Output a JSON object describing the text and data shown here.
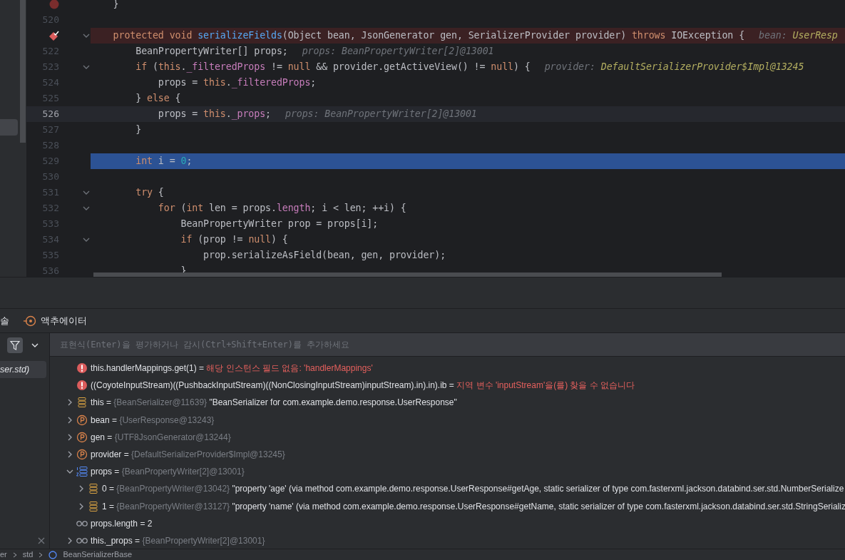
{
  "editor": {
    "lines": [
      {
        "breakpoint": true,
        "suspended": false,
        "foldable": false,
        "current": false,
        "execution_point": false,
        "tokens": [
          {
            "kind": "plain",
            "text": "    }"
          }
        ]
      },
      {
        "number": "520",
        "breakpoint": false,
        "suspended": false,
        "foldable": false,
        "current": false,
        "execution_point": false
      },
      {
        "breakpoint": true,
        "suspended": true,
        "foldable": true,
        "current": false,
        "execution_point": false,
        "tokens": [
          {
            "kind": "kw",
            "text": "    protected void"
          },
          {
            "kind": "fn",
            "text": " serializeFields"
          },
          {
            "kind": "plain",
            "text": "(Object bean, JsonGenerator gen, SerializerProvider provider)"
          },
          {
            "kind": "kw",
            "text": " throws"
          },
          {
            "kind": "plain",
            "text": " IOException {"
          }
        ],
        "hints": [
          {
            "label": "bean:",
            "value": "UserResp",
            "highlighted": true
          }
        ]
      },
      {
        "number": "522",
        "breakpoint": false,
        "suspended": false,
        "foldable": false,
        "current": false,
        "execution_point": false,
        "tokens": [
          {
            "kind": "plain",
            "text": "        BeanPropertyWriter[] props;"
          }
        ],
        "hints": [
          {
            "label": "props:",
            "value": "BeanPropertyWriter[2]@13001",
            "highlighted": false
          }
        ]
      },
      {
        "number": "523",
        "breakpoint": false,
        "suspended": false,
        "foldable": true,
        "current": false,
        "execution_point": false,
        "tokens": [
          {
            "kind": "kw",
            "text": "        if"
          },
          {
            "kind": "plain",
            "text": " ("
          },
          {
            "kind": "kw",
            "text": "this"
          },
          {
            "kind": "plain",
            "text": "."
          },
          {
            "kind": "field",
            "text": "_filteredProps"
          },
          {
            "kind": "plain",
            "text": " != "
          },
          {
            "kind": "kw",
            "text": "null"
          },
          {
            "kind": "plain",
            "text": " && provider.getActiveView() != "
          },
          {
            "kind": "kw",
            "text": "null"
          },
          {
            "kind": "plain",
            "text": ") {"
          }
        ],
        "hints": [
          {
            "label": "provider:",
            "value": "DefaultSerializerProvider$Impl@13245",
            "highlighted": true
          }
        ]
      },
      {
        "number": "524",
        "breakpoint": false,
        "suspended": false,
        "foldable": false,
        "current": false,
        "execution_point": false,
        "tokens": [
          {
            "kind": "plain",
            "text": "            props = "
          },
          {
            "kind": "kw",
            "text": "this"
          },
          {
            "kind": "plain",
            "text": "."
          },
          {
            "kind": "field",
            "text": "_filteredProps"
          },
          {
            "kind": "plain",
            "text": ";"
          }
        ]
      },
      {
        "number": "525",
        "breakpoint": false,
        "suspended": false,
        "foldable": false,
        "current": false,
        "execution_point": false,
        "tokens": [
          {
            "kind": "plain",
            "text": "        } "
          },
          {
            "kind": "kw",
            "text": "else"
          },
          {
            "kind": "plain",
            "text": " {"
          }
        ]
      },
      {
        "number": "526",
        "breakpoint": false,
        "suspended": false,
        "foldable": false,
        "current": true,
        "execution_point": false,
        "tokens": [
          {
            "kind": "plain",
            "text": "            props = "
          },
          {
            "kind": "kw",
            "text": "this"
          },
          {
            "kind": "plain",
            "text": "."
          },
          {
            "kind": "field",
            "text": "_props"
          },
          {
            "kind": "plain",
            "text": ";"
          }
        ],
        "hints": [
          {
            "label": "props:",
            "value": "BeanPropertyWriter[2]@13001",
            "highlighted": false
          }
        ]
      },
      {
        "number": "527",
        "breakpoint": false,
        "suspended": false,
        "foldable": false,
        "current": false,
        "execution_point": false,
        "tokens": [
          {
            "kind": "plain",
            "text": "        }"
          }
        ]
      },
      {
        "number": "528",
        "breakpoint": false,
        "suspended": false,
        "foldable": false,
        "current": false,
        "execution_point": false
      },
      {
        "number": "529",
        "breakpoint": false,
        "suspended": false,
        "foldable": false,
        "current": false,
        "execution_point": true,
        "tokens": [
          {
            "kind": "kw",
            "text": "        int"
          },
          {
            "kind": "plain",
            "text": " i = "
          },
          {
            "kind": "num",
            "text": "0"
          },
          {
            "kind": "plain",
            "text": ";"
          }
        ]
      },
      {
        "number": "530",
        "breakpoint": false,
        "suspended": false,
        "foldable": false,
        "current": false,
        "execution_point": false
      },
      {
        "number": "531",
        "breakpoint": false,
        "suspended": false,
        "foldable": true,
        "current": false,
        "execution_point": false,
        "tokens": [
          {
            "kind": "kw",
            "text": "        try"
          },
          {
            "kind": "plain",
            "text": " {"
          }
        ]
      },
      {
        "number": "532",
        "breakpoint": false,
        "suspended": false,
        "foldable": true,
        "current": false,
        "execution_point": false,
        "tokens": [
          {
            "kind": "kw",
            "text": "            for"
          },
          {
            "kind": "plain",
            "text": " ("
          },
          {
            "kind": "kw",
            "text": "int"
          },
          {
            "kind": "plain",
            "text": " len = props."
          },
          {
            "kind": "field",
            "text": "length"
          },
          {
            "kind": "plain",
            "text": "; i < len; ++i) {"
          }
        ]
      },
      {
        "number": "533",
        "breakpoint": false,
        "suspended": false,
        "foldable": false,
        "current": false,
        "execution_point": false,
        "tokens": [
          {
            "kind": "plain",
            "text": "                BeanPropertyWriter prop = props[i];"
          }
        ]
      },
      {
        "number": "534",
        "breakpoint": false,
        "suspended": false,
        "foldable": true,
        "current": false,
        "execution_point": false,
        "tokens": [
          {
            "kind": "kw",
            "text": "                if"
          },
          {
            "kind": "plain",
            "text": " (prop != "
          },
          {
            "kind": "kw",
            "text": "null"
          },
          {
            "kind": "plain",
            "text": ") {"
          }
        ]
      },
      {
        "number": "535",
        "breakpoint": false,
        "suspended": false,
        "foldable": false,
        "current": false,
        "execution_point": false,
        "tokens": [
          {
            "kind": "plain",
            "text": "                    prop.serializeAsField(bean, gen, provider);"
          }
        ]
      },
      {
        "number": "536",
        "breakpoint": false,
        "suspended": false,
        "foldable": false,
        "current": false,
        "execution_point": false,
        "tokens": [
          {
            "kind": "plain",
            "text": "                }"
          }
        ]
      }
    ]
  },
  "debugger": {
    "tabs": [
      {
        "kind": "plain",
        "label": "솔"
      },
      {
        "kind": "target",
        "label": "액추에이터"
      }
    ],
    "frames": [
      {
        "label": "ser.std)",
        "selected": true
      }
    ],
    "expression": {
      "placeholder": "표현식(Enter)을 평가하거나 감시(Ctrl+Shift+Enter)를 추가하세요"
    },
    "variables": [
      {
        "kind": "error",
        "name": "this.handlerMappings.get(1)",
        "sep": "=",
        "error": "해당 인스턴스 필드 없음: 'handlerMappings'"
      },
      {
        "kind": "error",
        "name": "((CoyoteInputStream)((PushbackInputStream)((NonClosingInputStream)inputStream).in).in).ib",
        "sep": "=",
        "error": "지역 변수 'inputStream'을(를) 찾을 수 없습니다"
      },
      {
        "kind": "object",
        "expanded": false,
        "name": "this",
        "sep": "=",
        "type": "{BeanSerializer@11639}",
        "value": "\"BeanSerializer for com.example.demo.response.UserResponse\""
      },
      {
        "kind": "param",
        "expanded": false,
        "name": "bean",
        "sep": "=",
        "type": "{UserResponse@13243}"
      },
      {
        "kind": "param",
        "expanded": false,
        "name": "gen",
        "sep": "=",
        "type": "{UTF8JsonGenerator@13244}"
      },
      {
        "kind": "param",
        "expanded": false,
        "name": "provider",
        "sep": "=",
        "type": "{DefaultSerializerProvider$Impl@13245}"
      },
      {
        "kind": "array",
        "expanded": true,
        "name": "props",
        "sep": "=",
        "type": "{BeanPropertyWriter[2]@13001}",
        "children": [
          {
            "kind": "object",
            "expanded": false,
            "name": "0",
            "sep": "=",
            "type": "{BeanPropertyWriter@13042}",
            "value": "\"property 'age' (via method com.example.demo.response.UserResponse#getAge, static serializer of type com.fasterxml.jackson.databind.ser.std.NumberSerialize"
          },
          {
            "kind": "object",
            "expanded": false,
            "name": "1",
            "sep": "=",
            "type": "{BeanPropertyWriter@13127}",
            "value": "\"property 'name' (via method com.example.demo.response.UserResponse#getName, static serializer of type com.fasterxml.jackson.databind.ser.std.StringSerializ"
          }
        ]
      },
      {
        "kind": "watch",
        "name": "props.length",
        "sep": "=",
        "value": "2"
      },
      {
        "kind": "watch",
        "expanded": false,
        "name": "this._props",
        "sep": "=",
        "type": "{BeanPropertyWriter[2]@13001}"
      }
    ],
    "breadcrumb": [
      "er",
      "std",
      "BeanSerializerBase"
    ]
  }
}
